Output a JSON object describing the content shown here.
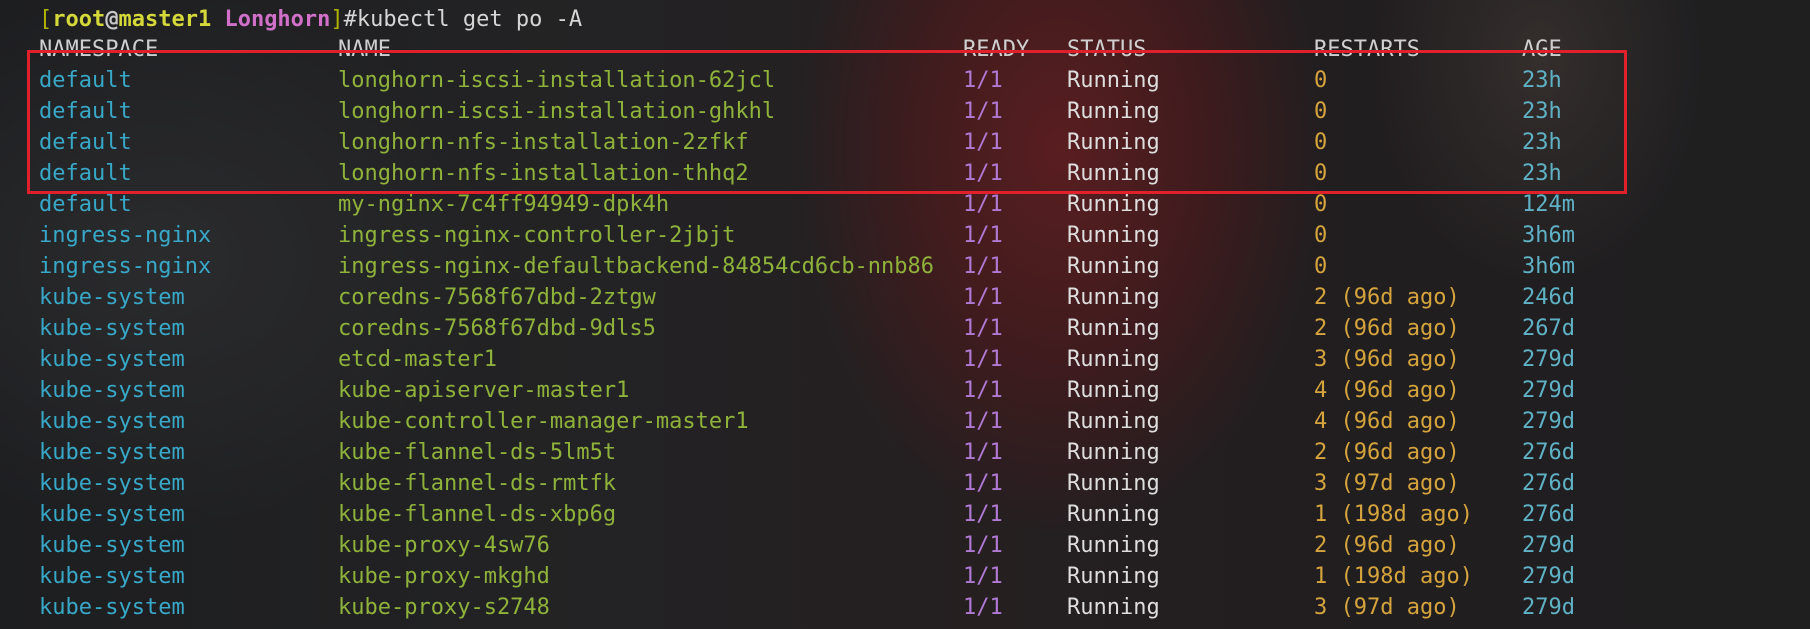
{
  "prompt": {
    "open_bracket": "[",
    "user": "root",
    "at": "@",
    "host": "master1",
    "space": " ",
    "dir": "Longhorn",
    "close_bracket": "]",
    "command": "#kubectl get po -A"
  },
  "table": {
    "headers": [
      "NAMESPACE",
      "NAME",
      "READY",
      "STATUS",
      "RESTARTS",
      "AGE"
    ],
    "rows": [
      {
        "namespace": "default",
        "name": "longhorn-iscsi-installation-62jcl",
        "ready": "1/1",
        "status": "Running",
        "restarts": "0",
        "age": "23h"
      },
      {
        "namespace": "default",
        "name": "longhorn-iscsi-installation-ghkhl",
        "ready": "1/1",
        "status": "Running",
        "restarts": "0",
        "age": "23h"
      },
      {
        "namespace": "default",
        "name": "longhorn-nfs-installation-2zfkf",
        "ready": "1/1",
        "status": "Running",
        "restarts": "0",
        "age": "23h"
      },
      {
        "namespace": "default",
        "name": "longhorn-nfs-installation-thhq2",
        "ready": "1/1",
        "status": "Running",
        "restarts": "0",
        "age": "23h"
      },
      {
        "namespace": "default",
        "name": "my-nginx-7c4ff94949-dpk4h",
        "ready": "1/1",
        "status": "Running",
        "restarts": "0",
        "age": "124m"
      },
      {
        "namespace": "ingress-nginx",
        "name": "ingress-nginx-controller-2jbjt",
        "ready": "1/1",
        "status": "Running",
        "restarts": "0",
        "age": "3h6m"
      },
      {
        "namespace": "ingress-nginx",
        "name": "ingress-nginx-defaultbackend-84854cd6cb-nnb86",
        "ready": "1/1",
        "status": "Running",
        "restarts": "0",
        "age": "3h6m"
      },
      {
        "namespace": "kube-system",
        "name": "coredns-7568f67dbd-2ztgw",
        "ready": "1/1",
        "status": "Running",
        "restarts": "2 (96d ago)",
        "age": "246d"
      },
      {
        "namespace": "kube-system",
        "name": "coredns-7568f67dbd-9dls5",
        "ready": "1/1",
        "status": "Running",
        "restarts": "2 (96d ago)",
        "age": "267d"
      },
      {
        "namespace": "kube-system",
        "name": "etcd-master1",
        "ready": "1/1",
        "status": "Running",
        "restarts": "3 (96d ago)",
        "age": "279d"
      },
      {
        "namespace": "kube-system",
        "name": "kube-apiserver-master1",
        "ready": "1/1",
        "status": "Running",
        "restarts": "4 (96d ago)",
        "age": "279d"
      },
      {
        "namespace": "kube-system",
        "name": "kube-controller-manager-master1",
        "ready": "1/1",
        "status": "Running",
        "restarts": "4 (96d ago)",
        "age": "279d"
      },
      {
        "namespace": "kube-system",
        "name": "kube-flannel-ds-5lm5t",
        "ready": "1/1",
        "status": "Running",
        "restarts": "2 (96d ago)",
        "age": "276d"
      },
      {
        "namespace": "kube-system",
        "name": "kube-flannel-ds-rmtfk",
        "ready": "1/1",
        "status": "Running",
        "restarts": "3 (97d ago)",
        "age": "276d"
      },
      {
        "namespace": "kube-system",
        "name": "kube-flannel-ds-xbp6g",
        "ready": "1/1",
        "status": "Running",
        "restarts": "1 (198d ago)",
        "age": "276d"
      },
      {
        "namespace": "kube-system",
        "name": "kube-proxy-4sw76",
        "ready": "1/1",
        "status": "Running",
        "restarts": "2 (96d ago)",
        "age": "279d"
      },
      {
        "namespace": "kube-system",
        "name": "kube-proxy-mkghd",
        "ready": "1/1",
        "status": "Running",
        "restarts": "1 (198d ago)",
        "age": "279d"
      },
      {
        "namespace": "kube-system",
        "name": "kube-proxy-s2748",
        "ready": "1/1",
        "status": "Running",
        "restarts": "3 (97d ago)",
        "age": "279d"
      }
    ]
  },
  "annotation": {
    "color": "#e0202a"
  }
}
